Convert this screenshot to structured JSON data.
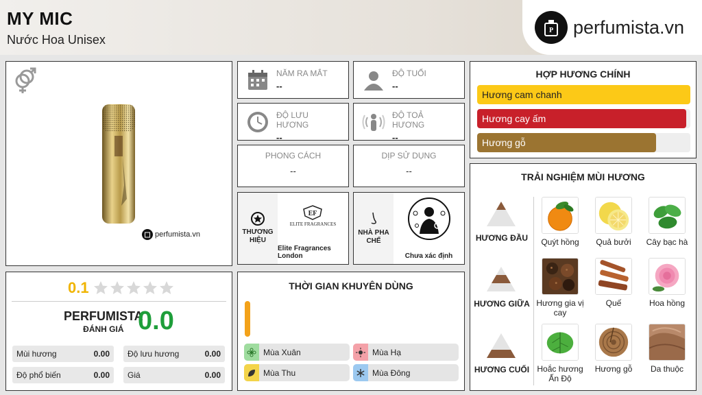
{
  "header": {
    "title": "MY MIC",
    "subtitle": "Nước Hoa Unisex",
    "logo_text": "perfumista.vn"
  },
  "product": {
    "watermark": "perfumista.vn",
    "gender_icon": "unisex-gender-icon"
  },
  "info": {
    "release_label": "NĂM RA MẮT",
    "release_value": "--",
    "age_label": "ĐỘ TUỔI",
    "age_value": "--",
    "longevity_label": "ĐỘ LƯU HƯƠNG",
    "longevity_value": "--",
    "sillage_label": "ĐỘ TOẢ HƯƠNG",
    "sillage_value": "--",
    "style_label": "PHONG CÁCH",
    "style_value": "--",
    "occasion_label": "DỊP SỬ DỤNG",
    "occasion_value": "--",
    "brand_label": "THƯƠNG HIỆU",
    "brand_name": "Elite Fragrances London",
    "brand_logo_text": "ELITE FRAGRANCES",
    "perfumer_label": "NHÀ PHA CHẾ",
    "perfumer_name": "Chưa xác định"
  },
  "accords": {
    "title": "HỢP HƯƠNG CHÍNH",
    "items": [
      {
        "label": "Hương cam chanh",
        "color": "#fcc917",
        "text_color": "#222",
        "fraction": 1.0
      },
      {
        "label": "Hương cay ấm",
        "color": "#c8202a",
        "text_color": "#fff",
        "fraction": 0.98
      },
      {
        "label": "Hương gỗ",
        "color": "#9b7431",
        "text_color": "#fff",
        "fraction": 0.84
      }
    ]
  },
  "notes": {
    "title": "TRẢI NGHIỆM MÙI HƯƠNG",
    "top_label": "HƯƠNG ĐẦU",
    "middle_label": "HƯƠNG GIỮA",
    "base_label": "HƯƠNG CUỐI",
    "top": [
      "Quýt hồng",
      "Quả bưởi",
      "Cây bạc hà"
    ],
    "middle": [
      "Hương gia vị cay",
      "Quế",
      "Hoa hồng"
    ],
    "base": [
      "Hoắc hương Ấn Độ",
      "Hương gỗ",
      "Da thuộc"
    ]
  },
  "rating": {
    "score": "0.1",
    "stars_filled": 0,
    "stars_total": 5,
    "brand": "PERFUMISTA",
    "sub": "ĐÁNH GIÁ",
    "big_score": "0.0",
    "rows": [
      {
        "label": "Mùi hương",
        "value": "0.00"
      },
      {
        "label": "Độ lưu hương",
        "value": "0.00"
      },
      {
        "label": "Độ phổ biến",
        "value": "0.00"
      },
      {
        "label": "Giá",
        "value": "0.00"
      }
    ]
  },
  "time": {
    "title": "THỜI GIAN KHUYÊN DÙNG",
    "seasons": [
      {
        "label": "Mùa Xuân",
        "color": "#9fdc9f"
      },
      {
        "label": "Mùa Hạ",
        "color": "#f4a1a8"
      },
      {
        "label": "Mùa Thu",
        "color": "#f3d44a"
      },
      {
        "label": "Mùa Đông",
        "color": "#9cc9f0"
      }
    ]
  }
}
